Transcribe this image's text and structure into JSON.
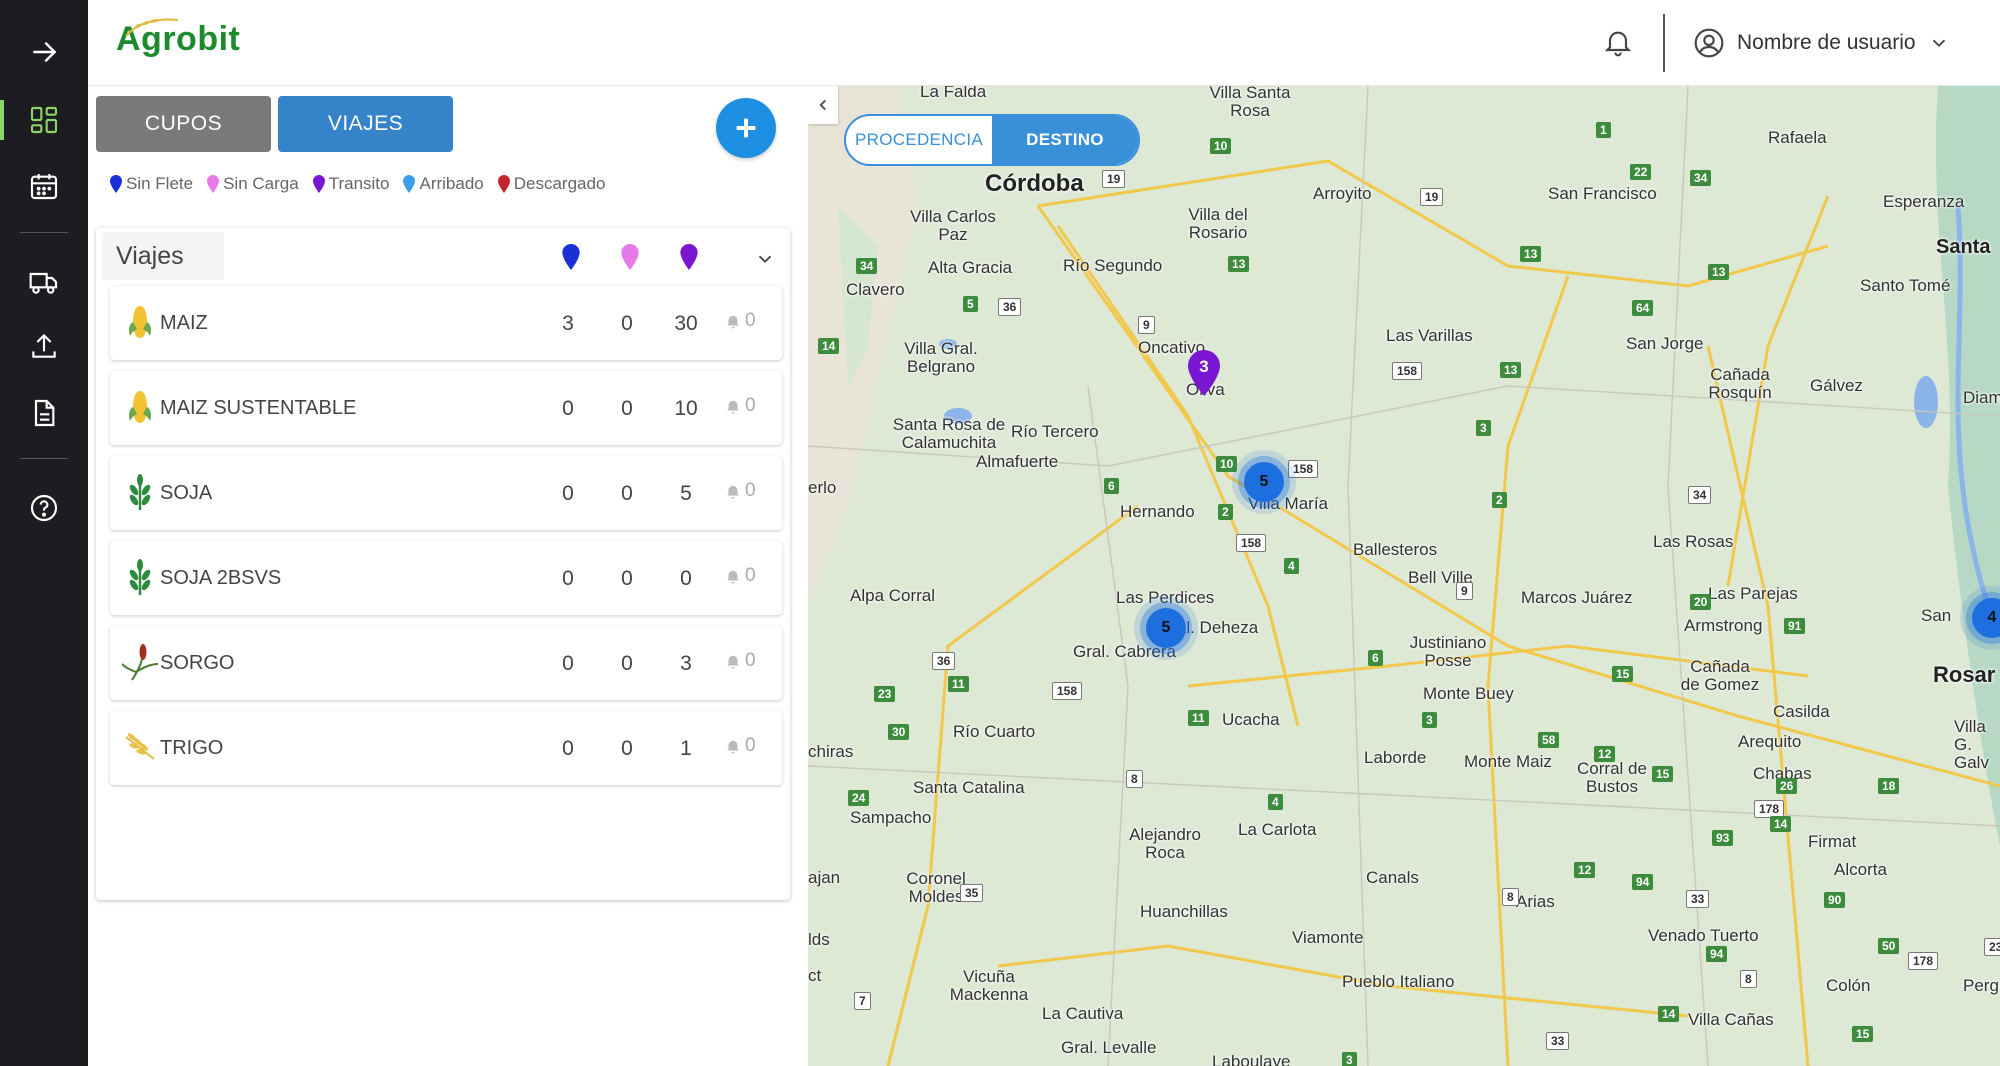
{
  "app": {
    "name": "Agrobit"
  },
  "header": {
    "user_name": "Nombre de usuario"
  },
  "tabs": {
    "cupos": "CUPOS",
    "viajes": "VIAJES"
  },
  "legend": [
    {
      "label": "Sin Flete",
      "color": "#1a2fd6"
    },
    {
      "label": "Sin Carga",
      "color": "#e57ae8"
    },
    {
      "label": "Transito",
      "color": "#7a16d1"
    },
    {
      "label": "Arribado",
      "color": "#3a9ee8"
    },
    {
      "label": "Descargado",
      "color": "#c2262b"
    }
  ],
  "card": {
    "title": "Viajes",
    "columns": [
      {
        "color": "#1a2fd6"
      },
      {
        "color": "#e57ae8"
      },
      {
        "color": "#7a16d1"
      }
    ],
    "rows": [
      {
        "label": "MAIZ",
        "icon": "corn-icon",
        "c1": "3",
        "c2": "0",
        "c3": "30",
        "alerts": "0"
      },
      {
        "label": "MAIZ SUSTENTABLE",
        "icon": "corn-icon",
        "c1": "0",
        "c2": "0",
        "c3": "10",
        "alerts": "0"
      },
      {
        "label": "SOJA",
        "icon": "soy-icon",
        "c1": "0",
        "c2": "0",
        "c3": "5",
        "alerts": "0"
      },
      {
        "label": "SOJA 2BSVS",
        "icon": "soy-icon",
        "c1": "0",
        "c2": "0",
        "c3": "0",
        "alerts": "0"
      },
      {
        "label": "SORGO",
        "icon": "sorghum-icon",
        "c1": "0",
        "c2": "0",
        "c3": "3",
        "alerts": "0"
      },
      {
        "label": "TRIGO",
        "icon": "wheat-icon",
        "c1": "0",
        "c2": "0",
        "c3": "1",
        "alerts": "0"
      }
    ]
  },
  "map": {
    "toggle": {
      "procedencia": "PROCEDENCIA",
      "destino": "DESTINO"
    },
    "clusters": [
      "5",
      "5",
      "4"
    ],
    "pin_count": "3",
    "cities": {
      "cordoba": "Córdoba",
      "la_falda": "La Falda",
      "villa_santa_rosa": "Villa Santa Rosa",
      "villa_carlos_paz": "Villa Carlos Paz",
      "alta_gracia": "Alta Gracia",
      "rio_segundo": "Río Segundo",
      "villa_del_rosario": "Villa del Rosario",
      "arroyito": "Arroyito",
      "san_francisco": "San Francisco",
      "rafaela": "Rafaela",
      "esperanza": "Esperanza",
      "santa": "Santa",
      "santo_tome": "Santo Tomé",
      "clavero": "Clavero",
      "villa_gral_belgrano": "Villa Gral. Belgrano",
      "oncativo": "Oncativo",
      "oliva": "Oliva",
      "las_varillas": "Las Varillas",
      "san_jorge": "San Jorge",
      "canada_rosquin": "Cañada Rosquín",
      "galvez": "Gálvez",
      "diam": "Diama",
      "santa_rosa_calamuchita": "Santa Rosa de Calamuchita",
      "rio_tercero": "Río Tercero",
      "almafuerte": "Almafuerte",
      "hernando": "Hernando",
      "villa_maria": "Villa María",
      "ballesteros": "Ballesteros",
      "las_rosas": "Las Rosas",
      "bell_ville": "Bell Ville",
      "marcos_juarez": "Marcos Juárez",
      "las_parejas": "Las Parejas",
      "armstrong": "Armstrong",
      "alpa_corral": "Alpa Corral",
      "las_perdices": "Las Perdices",
      "gral_deheza": "Gral. Deheza",
      "gral_cabrera": "Gral. Cabrera",
      "justiniano_posse": "Justiniano Posse",
      "canada_gomez": "Cañada de Gomez",
      "monte_buey": "Monte Buey",
      "casilda": "Casilda",
      "rosario": "Rosar",
      "san_lorenzo": "San",
      "rio_cuarto": "Río Cuarto",
      "ucacha": "Ucacha",
      "laborde": "Laborde",
      "monte_maiz": "Monte Maiz",
      "corral_bustos": "Corral de Bustos",
      "arequito": "Arequito",
      "villa_gob": "Villa G. Galv",
      "santa_catalina": "Santa Catalina",
      "chabas": "Chabas",
      "sampacho": "Sampacho",
      "alejandro_roca": "Alejandro Roca",
      "la_carlota": "La Carlota",
      "firmat": "Firmat",
      "coronel_moldes": "Coronel Moldes",
      "canals": "Canals",
      "alcorta": "Alcorta",
      "arias": "Arias",
      "huanchillas": "Huanchillas",
      "venado_tuerto": "Venado Tuerto",
      "viamonte": "Viamonte",
      "vicuna_mackenna": "Vicuña Mackenna",
      "pueblo_italiano": "Pueblo Italiano",
      "colon": "Colón",
      "la_cautiva": "La Cautiva",
      "villa_canas": "Villa Cañas",
      "gral_levalle": "Gral. Levalle",
      "laboulaye": "Laboulaye",
      "erlo": "erlo",
      "chiras": "chiras",
      "ajan": "ajan",
      "lds": "lds",
      "ct": "ct",
      "perg": "Perg"
    }
  }
}
